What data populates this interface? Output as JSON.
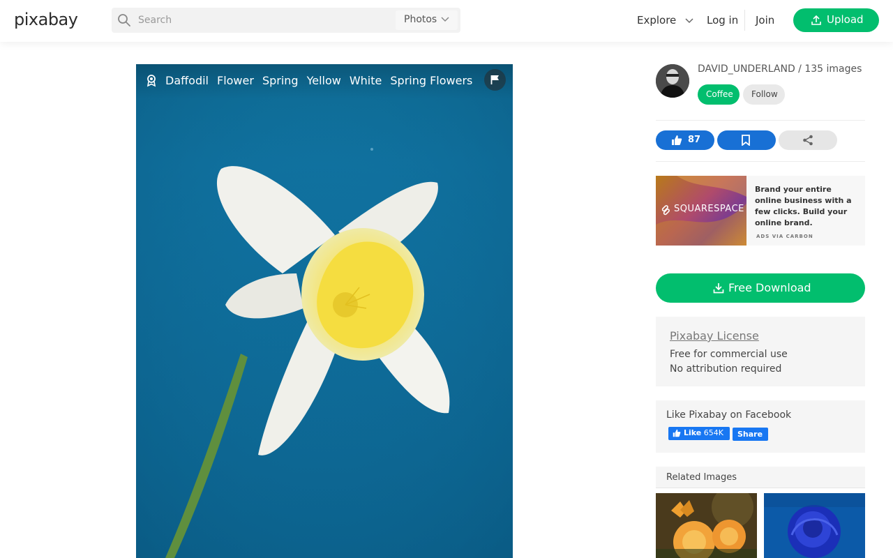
{
  "header": {
    "logo": "pixabay",
    "search_placeholder": "Search",
    "search_type": "Photos",
    "explore": "Explore",
    "login": "Log in",
    "join": "Join",
    "upload": "Upload"
  },
  "photo": {
    "tags": [
      "Daffodil",
      "Flower",
      "Spring",
      "Yellow",
      "White",
      "Spring Flowers"
    ]
  },
  "author": {
    "name_line": "DAVID_UNDERLAND / 135 images",
    "coffee": "Coffee",
    "follow": "Follow"
  },
  "actions": {
    "likes": "87"
  },
  "ad": {
    "brand": "SQUARESPACE",
    "text": "Brand your entire online business with a few clicks. Build your online brand.",
    "via": "ADS VIA CARBON"
  },
  "download": {
    "label": "Free Download"
  },
  "license": {
    "title": "Pixabay License",
    "line1": "Free for commercial use",
    "line2": "No attribution required"
  },
  "facebook": {
    "title": "Like Pixabay on Facebook",
    "like_label": "Like",
    "like_count": "654K",
    "share_label": "Share"
  },
  "related": {
    "title": "Related Images"
  },
  "colors": {
    "brand_green": "#02be6e",
    "action_blue": "#1870d5",
    "facebook_blue": "#1877f2"
  }
}
